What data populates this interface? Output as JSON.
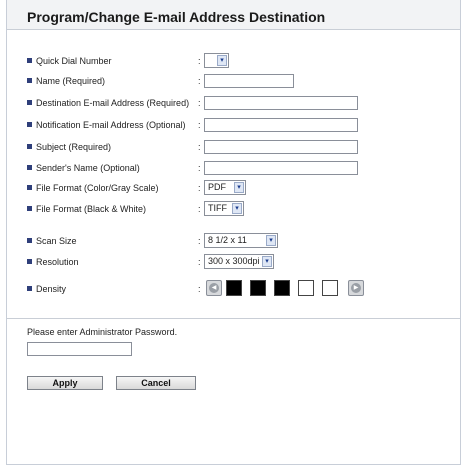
{
  "header": {
    "title": "Program/Change E-mail Address Destination"
  },
  "form": {
    "quick_dial": {
      "label": "Quick Dial Number",
      "colon": ":",
      "value": ""
    },
    "name": {
      "label": "Name (Required)",
      "colon": ":",
      "value": ""
    },
    "dest_email": {
      "label": "Destination E-mail Address (Required)",
      "colon": ":",
      "value": ""
    },
    "notif_email": {
      "label": "Notification E-mail Address (Optional)",
      "colon": ":",
      "value": ""
    },
    "subject": {
      "label": "Subject (Required)",
      "colon": ":",
      "value": ""
    },
    "sender": {
      "label": "Sender's Name (Optional)",
      "colon": ":",
      "value": ""
    },
    "file_color": {
      "label": "File Format (Color/Gray Scale)",
      "colon": ":",
      "value": "PDF"
    },
    "file_bw": {
      "label": "File Format (Black & White)",
      "colon": ":",
      "value": "TIFF"
    },
    "scan_size": {
      "label": "Scan Size",
      "colon": ":",
      "value": "8 1/2 x 11"
    },
    "resolution": {
      "label": "Resolution",
      "colon": ":",
      "value": "300 x 300dpi"
    },
    "density": {
      "label": "Density",
      "colon": ":",
      "level": 3,
      "max": 5
    },
    "arrow_glyph": "▾"
  },
  "password": {
    "label": "Please enter Administrator Password.",
    "value": ""
  },
  "buttons": {
    "apply": "Apply",
    "cancel": "Cancel"
  },
  "colors": {
    "bullet": "#2f3f7a",
    "header_bg": "#f2f3f5",
    "density_fill": "#000000"
  }
}
